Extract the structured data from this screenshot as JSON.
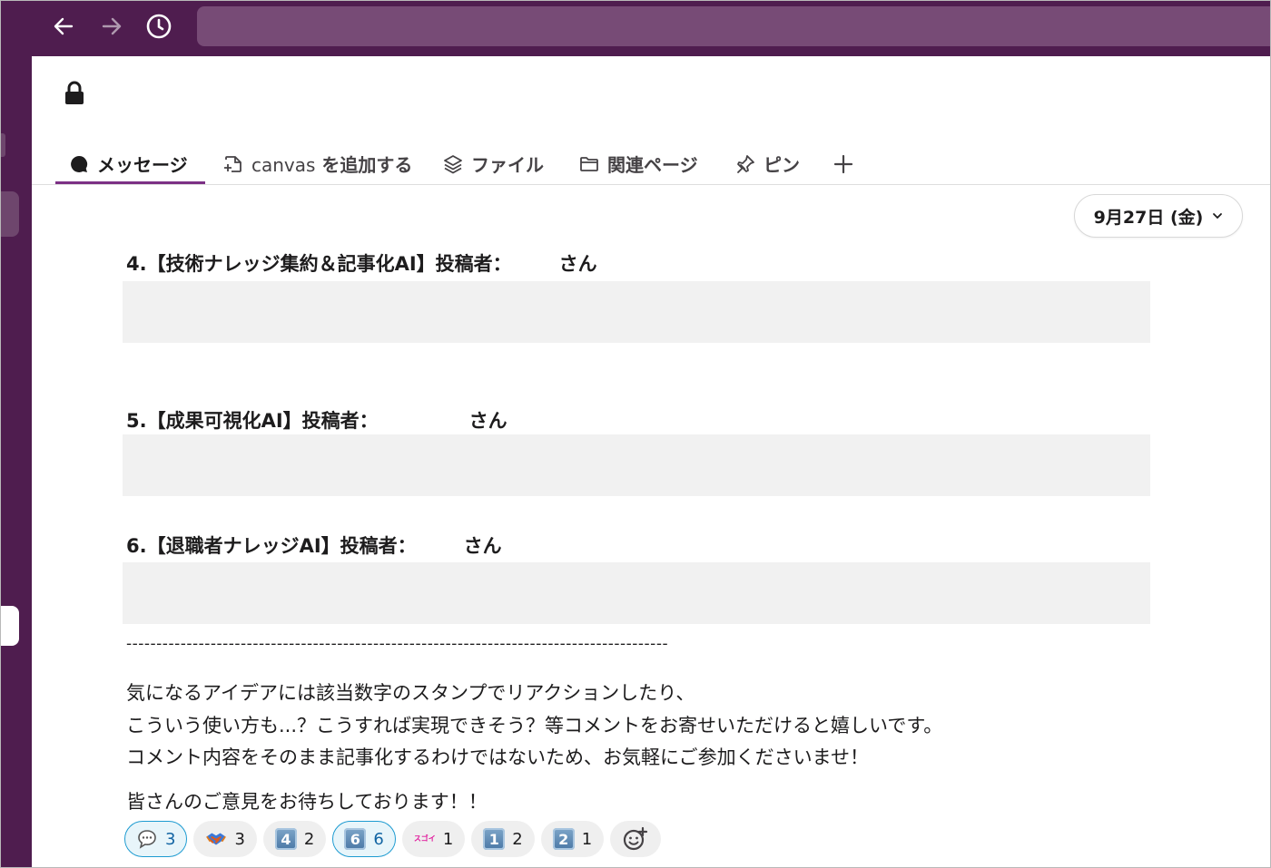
{
  "tabs": [
    {
      "label": "メッセージ",
      "active": true
    },
    {
      "label_prefix": "canvas",
      "label": " を追加する"
    },
    {
      "label": "ファイル"
    },
    {
      "label": "関連ページ"
    },
    {
      "label": "ピン"
    }
  ],
  "date_pill": {
    "label": "9月27日 (金)"
  },
  "sections": [
    {
      "prefix": "4.【技術ナレッジ集約＆記事化AI】投稿者：",
      "suffix": "さん"
    },
    {
      "prefix": "5.【成果可視化AI】投稿者：",
      "suffix": "さん"
    },
    {
      "prefix": "6.【退職者ナレッジAI】投稿者：",
      "suffix": "さん"
    }
  ],
  "divider": "------------------------------------------------------------------------------------------",
  "paragraph_lines": [
    "気になるアイデアには該当数字のスタンプでリアクションしたり、",
    "こういう使い方も...？こうすれば実現できそう？等コメントをお寄せいただけると嬉しいです。",
    "コメント内容をそのまま記事化するわけではないため、お気軽にご参加くださいませ！"
  ],
  "closing": "皆さんのご意見をお待ちしております！！",
  "reactions": [
    {
      "emoji": "speech-bubble",
      "count": "3",
      "selected": true
    },
    {
      "emoji": "handshake",
      "count": "3",
      "selected": false
    },
    {
      "emoji": "keycap-4",
      "key": "4",
      "count": "2",
      "selected": false
    },
    {
      "emoji": "keycap-6",
      "key": "6",
      "count": "6",
      "selected": true
    },
    {
      "emoji": "custom-stamp",
      "stamp_text": "スゴイ",
      "count": "1",
      "selected": false
    },
    {
      "emoji": "keycap-1",
      "key": "1",
      "count": "2",
      "selected": false
    },
    {
      "emoji": "keycap-2",
      "key": "2",
      "count": "1",
      "selected": false
    }
  ]
}
